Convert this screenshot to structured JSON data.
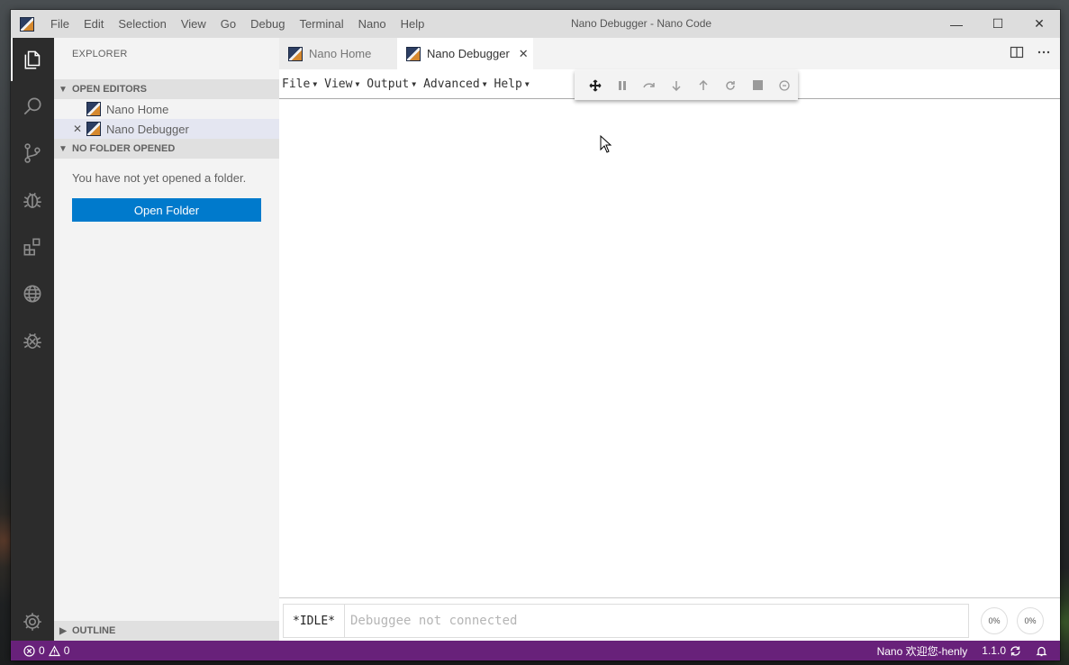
{
  "window": {
    "title": "Nano Debugger - Nano Code",
    "controls": {
      "minimize": "—",
      "maximize": "☐",
      "close": "✕"
    }
  },
  "menubar": [
    "File",
    "Edit",
    "Selection",
    "View",
    "Go",
    "Debug",
    "Terminal",
    "Nano",
    "Help"
  ],
  "activitybar": [
    "explorer-icon",
    "search-icon",
    "source-control-icon",
    "debug-icon",
    "extensions-icon",
    "remote-globe-icon",
    "nano-debug-icon",
    "settings-gear-icon"
  ],
  "sidebar": {
    "title": "EXPLORER",
    "open_editors": {
      "header": "OPEN EDITORS",
      "items": [
        {
          "label": "Nano Home"
        },
        {
          "label": "Nano Debugger",
          "close": "✕"
        }
      ]
    },
    "no_folder": {
      "header": "NO FOLDER OPENED",
      "message": "You have not yet opened a folder.",
      "button": "Open Folder"
    },
    "outline": {
      "header": "OUTLINE"
    }
  },
  "tabs": [
    {
      "label": "Nano Home"
    },
    {
      "label": "Nano Debugger",
      "close": "✕"
    }
  ],
  "debugger": {
    "menus": [
      "File",
      "View",
      "Output",
      "Advanced",
      "Help"
    ],
    "toolbar": [
      "connect-plus-icon",
      "pause-icon",
      "step-over-icon",
      "step-into-icon",
      "step-out-icon",
      "restart-icon",
      "stop-icon",
      "disconnect-icon"
    ],
    "console": {
      "state": "*IDLE*",
      "placeholder": "Debuggee not connected",
      "cpu": "0%",
      "mem": "0%"
    }
  },
  "statusbar": {
    "errors": "0",
    "warnings": "0",
    "user": "Nano 欢迎您-henly",
    "version": "1.1.0"
  },
  "colors": {
    "statusbar": "#68217a",
    "activitybar": "#2c2c2c",
    "button": "#007acc"
  }
}
